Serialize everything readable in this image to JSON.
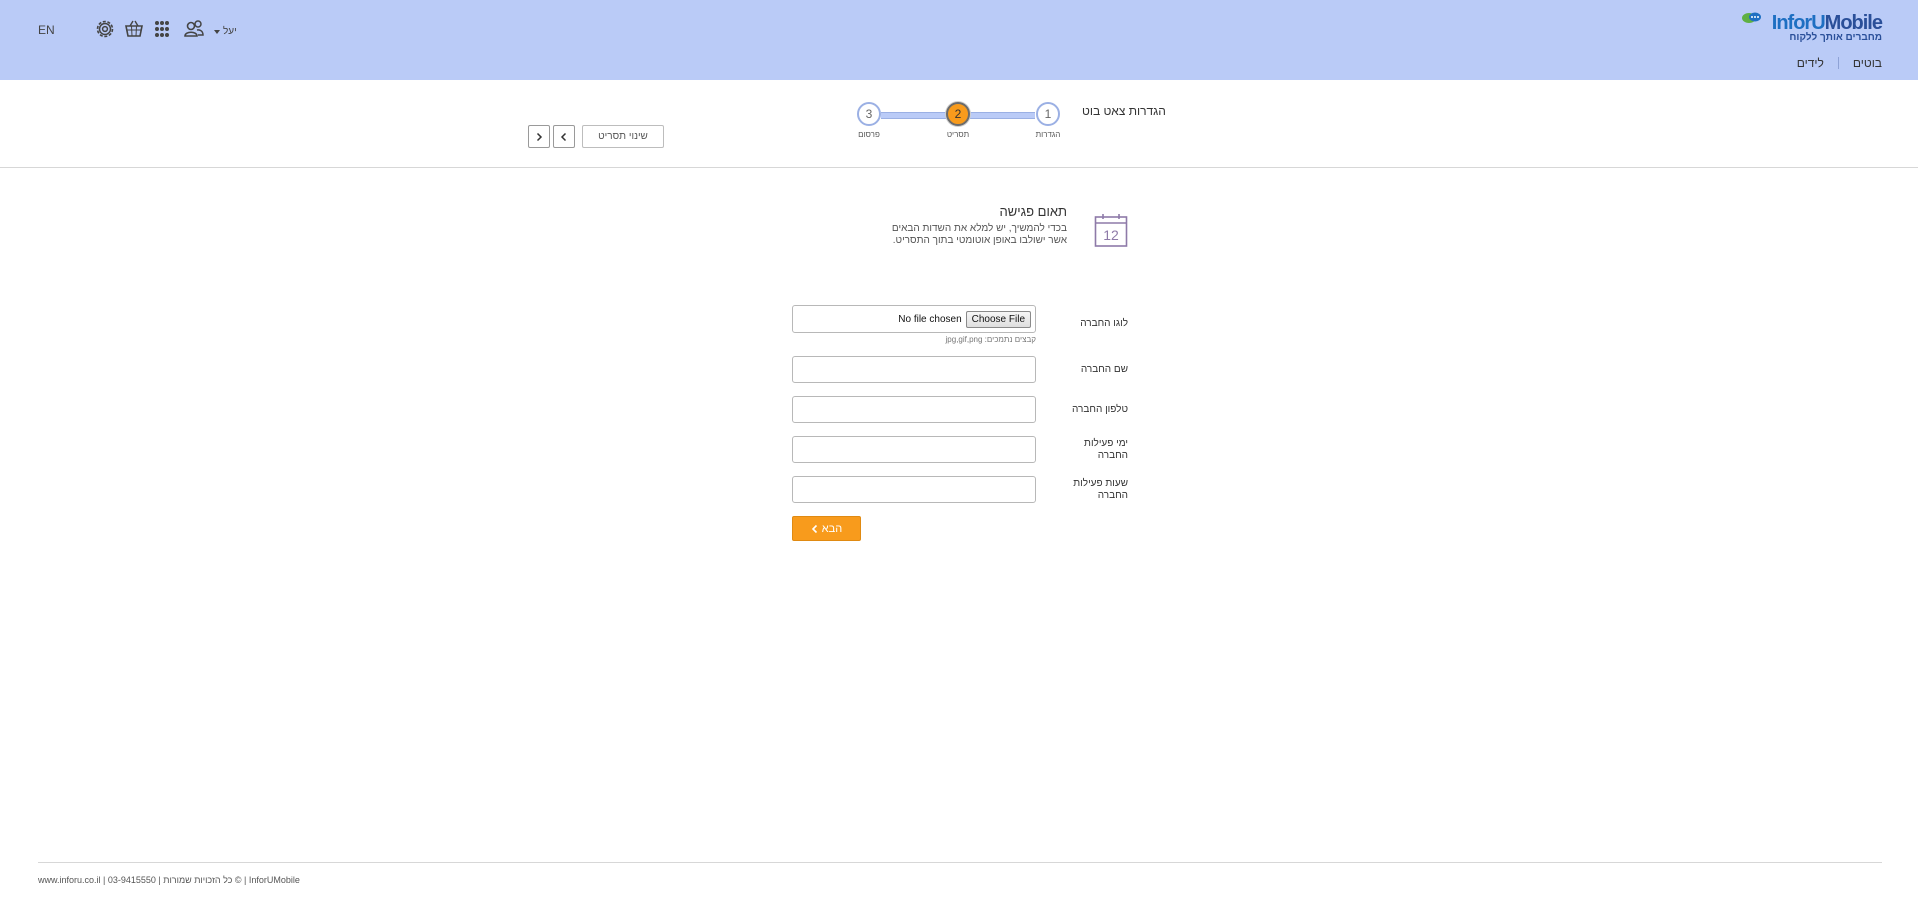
{
  "header": {
    "logo_brand_a": "InforU",
    "logo_brand_b": "Mobile",
    "logo_tagline": "מחברים אותך ללקוח",
    "nav": [
      "בוטים",
      "לידים"
    ],
    "lang": "EN",
    "user_name": "יעל",
    "icons": [
      "settings-icon",
      "basket-icon",
      "apps-grid-icon",
      "users-icon"
    ],
    "background_color": "#bacbf7"
  },
  "wizard": {
    "title": "הגדרות צאט בוט",
    "steps": [
      {
        "number": "1",
        "label": "הגדרות",
        "active": false
      },
      {
        "number": "2",
        "label": "תסריט",
        "active": true
      },
      {
        "number": "3",
        "label": "פרסום",
        "active": false
      }
    ],
    "change_template_label": "שינוי תסריט",
    "active_color": "#f89b1c"
  },
  "section": {
    "title": "תאום פגישה",
    "description": "בכדי להמשיך, יש למלא את השדות הבאים אשר ישולבו באופן אוטומטי בתוך התסריט.",
    "icon_number": "12"
  },
  "form": {
    "logo_label": "לוגו החברה",
    "choose_file_label": "Choose File",
    "file_status": "No file chosen",
    "file_hint": "קבצים נתמכים: jpg,gif,png",
    "fields": [
      {
        "label": "שם החברה",
        "value": ""
      },
      {
        "label": "טלפון החברה",
        "value": ""
      },
      {
        "label": "ימי פעילות החברה",
        "value": ""
      },
      {
        "label": "שעות פעילות החברה",
        "value": ""
      }
    ],
    "next_label": "הבא"
  },
  "footer": {
    "text": "www.inforu.co.il | 03-9415550 | כל הזכויות שמורות © | InforUMobile"
  }
}
